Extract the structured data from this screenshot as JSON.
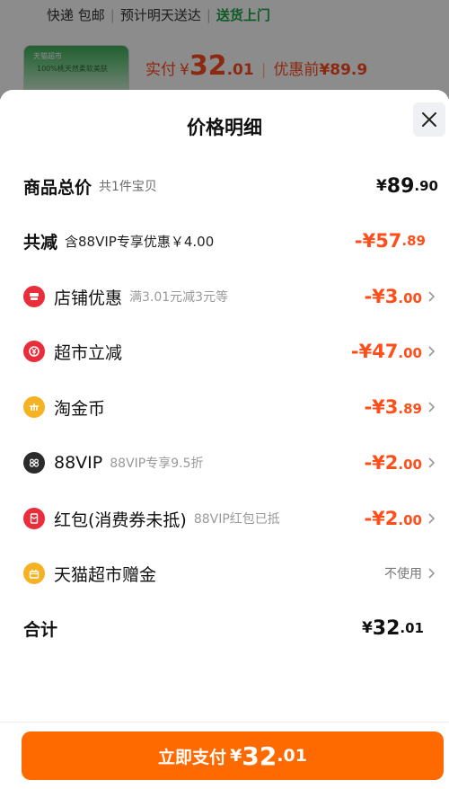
{
  "background": {
    "delivery": [
      "快递 包邮",
      "预计明天送达",
      "送货上门"
    ],
    "thumb_text": [
      "天猫超市",
      "100%桃天然柔软美肤"
    ],
    "price_label": "实付",
    "price_currency": "¥",
    "price_int": "32",
    "price_dec": ".01",
    "orig_label": "优惠前",
    "orig_price": "¥89.9"
  },
  "sheet": {
    "title": "价格明细"
  },
  "summary": {
    "total_label": "商品总价",
    "total_sub": "共1件宝贝",
    "total_cur": "¥",
    "total_int": "89",
    "total_dec": ".90",
    "reduce_label": "共减",
    "reduce_sub": "含88VIP专享优惠￥4.00",
    "reduce_prefix": "-¥",
    "reduce_int": "57",
    "reduce_dec": ".89"
  },
  "items": [
    {
      "label": "店铺优惠",
      "sub": "满3.01元减3元等",
      "prefix": "-¥",
      "int": "3",
      "dec": ".00",
      "icon": "store-coupon-icon",
      "color": "#ea2d3a"
    },
    {
      "label": "超市立减",
      "sub": "",
      "prefix": "-¥",
      "int": "47",
      "dec": ".00",
      "icon": "market-discount-icon",
      "color": "#ea2d3a"
    },
    {
      "label": "淘金币",
      "sub": "",
      "prefix": "-¥",
      "int": "3",
      "dec": ".89",
      "icon": "gold-coin-icon",
      "color": "#f5b324"
    },
    {
      "label": "88VIP",
      "sub": "88VIP专享9.5折",
      "prefix": "-¥",
      "int": "2",
      "dec": ".00",
      "icon": "vip88-icon",
      "color": "#2b2b2b"
    },
    {
      "label": "红包(消费券未抵)",
      "sub": "88VIP红包已抵",
      "prefix": "-¥",
      "int": "2",
      "dec": ".00",
      "icon": "red-packet-icon",
      "color": "#ea2d3a"
    },
    {
      "label": "天猫超市赠金",
      "sub": "",
      "status": "不使用",
      "icon": "gift-gold-icon",
      "color": "#f5b324"
    }
  ],
  "total": {
    "label": "合计",
    "cur": "¥",
    "int": "32",
    "dec": ".01"
  },
  "pay": {
    "label": "立即支付",
    "cur": "¥",
    "int": "32",
    "dec": ".01"
  },
  "colors": {
    "accent": "#ff6a00",
    "discount": "#ff4e1a",
    "green": "#1aa64a"
  }
}
